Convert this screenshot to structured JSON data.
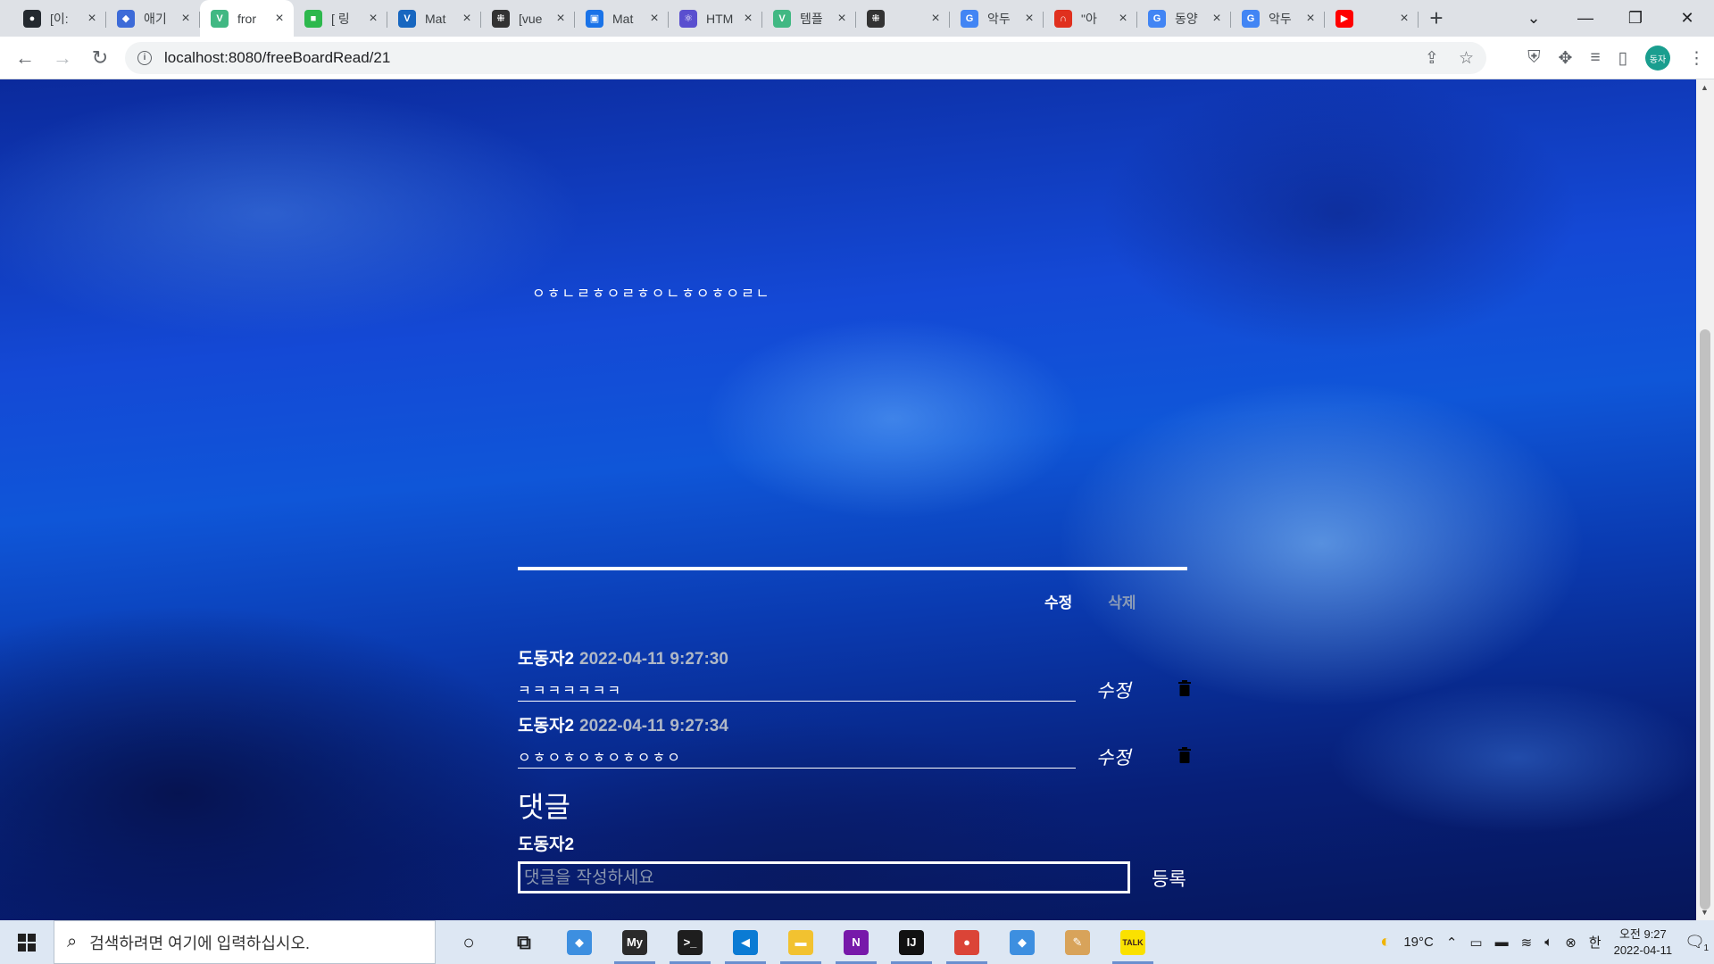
{
  "browser": {
    "tabs": [
      {
        "title": "[이:",
        "favicon": "github-icon",
        "color": "#24292f",
        "glyph": "●"
      },
      {
        "title": "애기",
        "favicon": "car-icon",
        "color": "#3d6bd8",
        "glyph": "◆"
      },
      {
        "title": "fror",
        "favicon": "vue-icon",
        "color": "#41b883",
        "glyph": "V",
        "active": true
      },
      {
        "title": "[ 링",
        "favicon": "book-icon",
        "color": "#2db84d",
        "glyph": "■"
      },
      {
        "title": "Mat",
        "favicon": "vuetify-icon",
        "color": "#1867c0",
        "glyph": "V"
      },
      {
        "title": "[vue",
        "favicon": "hub-icon",
        "color": "#333333",
        "glyph": "⁜"
      },
      {
        "title": "Mat",
        "favicon": "frame-icon",
        "color": "#1a73e8",
        "glyph": "▣"
      },
      {
        "title": "HTM",
        "favicon": "react-icon",
        "color": "#5a4fcf",
        "glyph": "⚛"
      },
      {
        "title": "템플",
        "favicon": "vue-icon",
        "color": "#41b883",
        "glyph": "V"
      },
      {
        "title": "",
        "favicon": "hub-icon",
        "color": "#333333",
        "glyph": "⁜"
      },
      {
        "title": "악두",
        "favicon": "google-icon",
        "color": "#4285f4",
        "glyph": "G"
      },
      {
        "title": "\"아",
        "favicon": "magnet-icon",
        "color": "#e0301e",
        "glyph": "∩"
      },
      {
        "title": "동양",
        "favicon": "google-icon",
        "color": "#4285f4",
        "glyph": "G"
      },
      {
        "title": "악두",
        "favicon": "google-icon",
        "color": "#4285f4",
        "glyph": "G"
      },
      {
        "title": "",
        "favicon": "youtube-icon",
        "color": "#ff0000",
        "glyph": "▶"
      }
    ],
    "url": "localhost:8080/freeBoardRead/21",
    "profile_label": "동자"
  },
  "post": {
    "body": "ㅇㅎㄴㄹㅎㅇㄹㅎㅇㄴㅎㅇㅎㅇㄹㄴ",
    "edit_label": "수정",
    "delete_label": "삭제"
  },
  "comments": [
    {
      "author": "도동자2",
      "date": "2022-04-11 9:27:30",
      "text": "ㅋㅋㅋㅋㅋㅋㅋ",
      "edit_label": "수정"
    },
    {
      "author": "도동자2",
      "date": "2022-04-11 9:27:34",
      "text": "ㅇㅎㅇㅎㅇㅎㅇㅎㅇㅎㅇ",
      "edit_label": "수정"
    }
  ],
  "reply": {
    "title": "댓글",
    "user": "도동자2",
    "placeholder": "댓글을 작성하세요",
    "submit_label": "등록"
  },
  "taskbar": {
    "search_placeholder": "검색하려면 여기에 입력하십시오.",
    "weather": "19°C",
    "ime": "한",
    "time": "오전 9:27",
    "date": "2022-04-11",
    "notification_count": "1",
    "apps": [
      {
        "name": "cortana-icon",
        "glyph": "○",
        "color": "transparent",
        "fg": "#202020"
      },
      {
        "name": "task-view-icon",
        "glyph": "⧉",
        "color": "transparent",
        "fg": "#202020"
      },
      {
        "name": "sourcetree-icon",
        "glyph": "◆",
        "color": "#3d8fe0",
        "fg": "#fff"
      },
      {
        "name": "mysql-icon",
        "glyph": "My",
        "color": "#2b2b2b",
        "fg": "#fff",
        "open": true
      },
      {
        "name": "terminal-icon",
        "glyph": ">_",
        "color": "#1e1e1e",
        "fg": "#fff",
        "open": true
      },
      {
        "name": "vscode-icon",
        "glyph": "◀",
        "color": "#0a7bd4",
        "fg": "#fff",
        "open": true
      },
      {
        "name": "file-explorer-icon",
        "glyph": "▬",
        "color": "#f2c230",
        "fg": "#fff",
        "open": true
      },
      {
        "name": "onenote-icon",
        "glyph": "N",
        "color": "#7719aa",
        "fg": "#fff",
        "open": true
      },
      {
        "name": "intellij-icon",
        "glyph": "IJ",
        "color": "#111111",
        "fg": "#fff",
        "open": true
      },
      {
        "name": "chrome-icon",
        "glyph": "●",
        "color": "#db4437",
        "fg": "#fff",
        "open": true
      },
      {
        "name": "sourcetree2-icon",
        "glyph": "◆",
        "color": "#3d8fe0",
        "fg": "#fff"
      },
      {
        "name": "paint-icon",
        "glyph": "✎",
        "color": "#d8a35a",
        "fg": "#fff"
      },
      {
        "name": "kakaotalk-icon",
        "glyph": "TALK",
        "color": "#fae100",
        "fg": "#3c1e1e",
        "open": true
      }
    ]
  }
}
